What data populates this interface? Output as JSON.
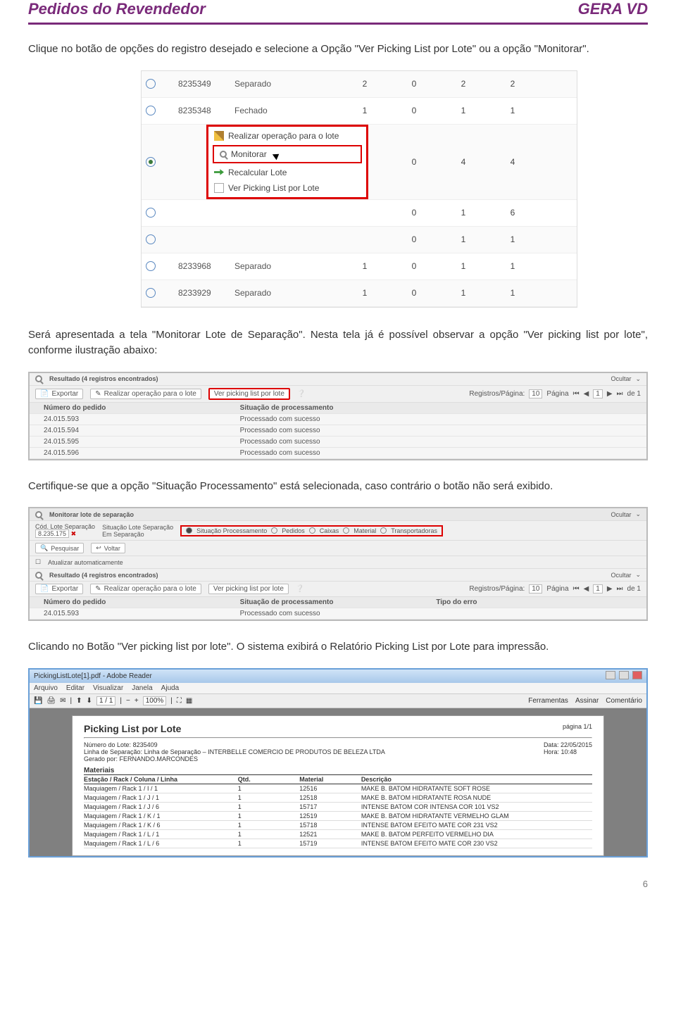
{
  "header": {
    "left": "Pedidos do Revendedor",
    "right": "GERA VD"
  },
  "p1": "Clique no botão de opções do registro desejado e selecione a Opção \"Ver Picking List por Lote\" ou a opção \"Monitorar\".",
  "shot1": {
    "rows": [
      {
        "id": "8235349",
        "status": "Separado",
        "c1": "2",
        "c2": "0",
        "c3": "2",
        "c4": "2"
      },
      {
        "id": "8235348",
        "status": "Fechado",
        "c1": "1",
        "c2": "0",
        "c3": "1",
        "c4": "1"
      },
      {
        "id": "",
        "status": "",
        "c1": "",
        "c2": "0",
        "c3": "4",
        "c4": "4",
        "selected": true
      },
      {
        "id": "",
        "status": "",
        "c1": "",
        "c2": "0",
        "c3": "1",
        "c4": "6"
      },
      {
        "id": "",
        "status": "",
        "c1": "",
        "c2": "0",
        "c3": "1",
        "c4": "1"
      },
      {
        "id": "8233968",
        "status": "Separado",
        "c1": "1",
        "c2": "0",
        "c3": "1",
        "c4": "1"
      },
      {
        "id": "8233929",
        "status": "Separado",
        "c1": "1",
        "c2": "0",
        "c3": "1",
        "c4": "1"
      }
    ],
    "menu": {
      "op": "Realizar operação para o lote",
      "monitorar": "Monitorar",
      "recalc": "Recalcular Lote",
      "ver": "Ver Picking List por Lote"
    }
  },
  "p2": "Será apresentada a tela \"Monitorar Lote de Separação\". Nesta tela já é possível observar a opção \"Ver picking list por lote\", conforme ilustração abaixo:",
  "shot2": {
    "resultado": "Resultado  (4 registros encontrados)",
    "ocultar": "Ocultar",
    "exportar": "Exportar",
    "realizar": "Realizar operação para o lote",
    "verpl": "Ver picking list por lote",
    "regpag_lbl": "Registros/Página:",
    "regpag_val": "10",
    "pag_lbl": "Página",
    "pag_of": "de 1",
    "pag_cur": "1",
    "col1": "Número do pedido",
    "col2": "Situação de processamento",
    "rows": [
      {
        "num": "24.015.593",
        "sit": "Processado com sucesso"
      },
      {
        "num": "24.015.594",
        "sit": "Processado com sucesso"
      },
      {
        "num": "24.015.595",
        "sit": "Processado com sucesso"
      },
      {
        "num": "24.015.596",
        "sit": "Processado com sucesso"
      }
    ]
  },
  "p3": "Certifique-se que a opção \"Situação Processamento\" está selecionada, caso contrário o botão não será exibido.",
  "shot3": {
    "title": "Monitorar lote de separação",
    "ocultar": "Ocultar",
    "cod_lbl": "Cód. Lote Separação",
    "cod_val": "8.235.175",
    "sit_lbl": "Situação Lote Separação",
    "sit_val": "Em Separação",
    "radios": [
      "Situação Processamento",
      "Pedidos",
      "Caixas",
      "Material",
      "Transportadoras"
    ],
    "pesquisar": "Pesquisar",
    "voltar": "Voltar",
    "atualizar": "Atualizar automaticamente",
    "resultado": "Resultado  (4 registros encontrados)",
    "exportar": "Exportar",
    "realizar": "Realizar operação para o lote",
    "verpl": "Ver picking list por lote",
    "regpag_lbl": "Registros/Página:",
    "regpag_val": "10",
    "pag_lbl": "Página",
    "pag_cur": "1",
    "pag_of": "de 1",
    "col1": "Número do pedido",
    "col2": "Situação de processamento",
    "col3": "Tipo do erro",
    "row_num": "24.015.593",
    "row_sit": "Processado com sucesso"
  },
  "p4": "Clicando no Botão \"Ver picking list por lote\". O sistema exibirá o Relatório Picking List por Lote para impressão.",
  "pdf": {
    "window_title": "PickingListLote[1].pdf - Adobe Reader",
    "menu": [
      "Arquivo",
      "Editar",
      "Visualizar",
      "Janela",
      "Ajuda"
    ],
    "page_ind": "1 / 1",
    "zoom": "100%",
    "tools": [
      "Ferramentas",
      "Assinar",
      "Comentário"
    ],
    "heading": "Picking List por Lote",
    "pagina": "página 1/1",
    "lote_lbl": "Número do Lote:",
    "lote_val": "8235409",
    "linha": "Linha de Separação: Linha de Separação – INTERBELLE COMERCIO DE PRODUTOS DE BELEZA LTDA",
    "gerado": "Gerado por: FERNANDO.MARCONDES",
    "data": "Data: 22/05/2015",
    "hora": "Hora: 10:48",
    "mat_title": "Materiais",
    "mh": [
      "Estação / Rack / Coluna / Linha",
      "Qtd.",
      "Material",
      "Descrição"
    ],
    "rows": [
      [
        "Maquiagem / Rack 1 / I / 1",
        "1",
        "12516",
        "MAKE B. BATOM HIDRATANTE SOFT ROSE"
      ],
      [
        "Maquiagem / Rack 1 / J / 1",
        "1",
        "12518",
        "MAKE B. BATOM HIDRATANTE ROSA NUDE"
      ],
      [
        "Maquiagem / Rack 1 / J / 6",
        "1",
        "15717",
        "INTENSE BATOM COR INTENSA COR 101 VS2"
      ],
      [
        "Maquiagem / Rack 1 / K / 1",
        "1",
        "12519",
        "MAKE B. BATOM HIDRATANTE VERMELHO GLAM"
      ],
      [
        "Maquiagem / Rack 1 / K / 6",
        "1",
        "15718",
        "INTENSE BATOM EFEITO MATE COR 231 VS2"
      ],
      [
        "Maquiagem / Rack 1 / L / 1",
        "1",
        "12521",
        "MAKE B. BATOM PERFEITO VERMELHO DIA"
      ],
      [
        "Maquiagem / Rack 1 / L / 6",
        "1",
        "15719",
        "INTENSE BATOM EFEITO MATE COR 230 VS2"
      ]
    ]
  },
  "page_number": "6"
}
